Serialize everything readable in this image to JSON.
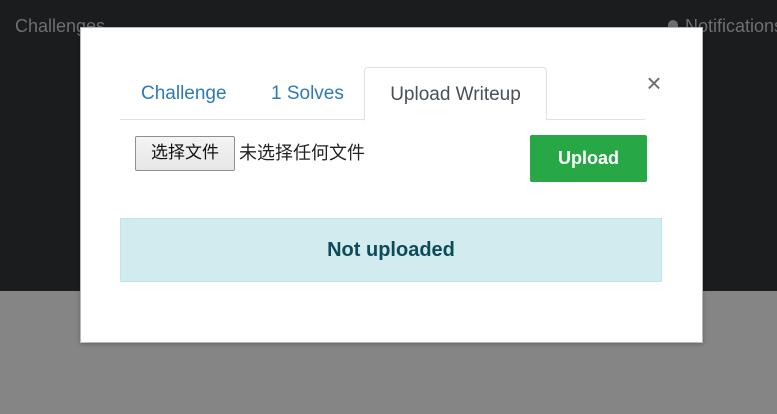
{
  "navbar": {
    "brand": "Challenges",
    "notifications": "Notifications"
  },
  "modal": {
    "close_glyph": "×",
    "tabs": [
      {
        "label": "Challenge",
        "active": false
      },
      {
        "label": "1 Solves",
        "active": false
      },
      {
        "label": "Upload Writeup",
        "active": true
      }
    ],
    "file_input": {
      "button_label": "选择文件",
      "status_text": "未选择任何文件"
    },
    "upload_button": "Upload",
    "alert_text": "Not uploaded"
  },
  "colors": {
    "navbar_bg": "#1b1c1e",
    "overlay_bg": "#858585",
    "tab_link": "#2d7ab8",
    "success": "#27a745",
    "alert_bg": "#d1ebef",
    "alert_text": "#0e4b59"
  },
  "icons": {
    "notifications": "bell-icon",
    "close": "close-icon"
  }
}
